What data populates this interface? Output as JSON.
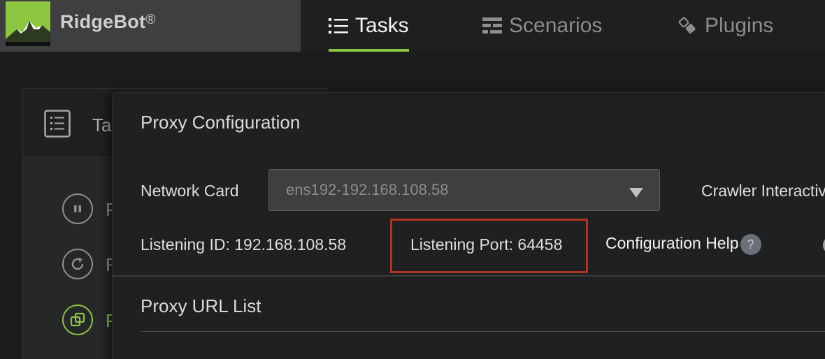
{
  "brand": {
    "name": "RidgeBot",
    "mark": "®"
  },
  "nav": {
    "tasks": "Tasks",
    "scenarios": "Scenarios",
    "plugins": "Plugins"
  },
  "sidepanel": {
    "title": "Ta",
    "items": [
      {
        "letter": "P",
        "icon": "pause-icon"
      },
      {
        "letter": "R",
        "icon": "refresh-icon"
      },
      {
        "letter": "P",
        "icon": "proxy-icon"
      }
    ]
  },
  "modal": {
    "title": "Proxy Configuration",
    "network_card_label": "Network Card",
    "network_card_value": "ens192-192.168.108.58",
    "crawler_label": "Crawler Interactive",
    "listening_id": "Listening ID: 192.168.108.58",
    "listening_port": "Listening Port: 64458",
    "config_help": "Configuration Help",
    "help_glyph": "?",
    "url_list_title": "Proxy URL List"
  },
  "colors": {
    "accent": "#8dc63f",
    "highlight": "#b5321e"
  }
}
